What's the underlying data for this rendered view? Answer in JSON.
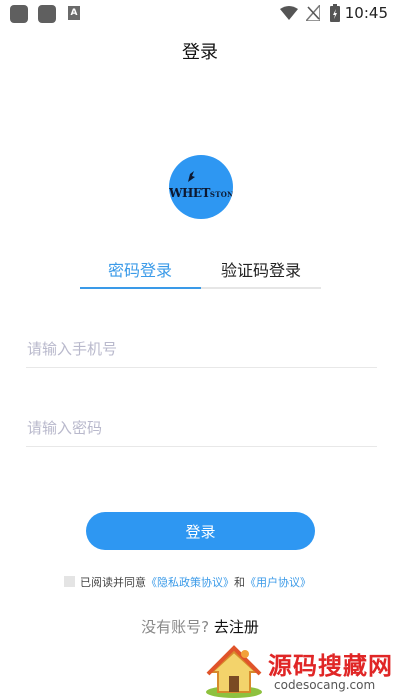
{
  "status_bar": {
    "time": "10:45",
    "badge": "A"
  },
  "header": {
    "title": "登录"
  },
  "logo": {
    "text_main": "WHET",
    "text_tail": "STONE"
  },
  "tabs": [
    {
      "label": "密码登录",
      "active": true
    },
    {
      "label": "验证码登录",
      "active": false
    }
  ],
  "form": {
    "phone_placeholder": "请输入手机号",
    "password_placeholder": "请输入密码",
    "login_label": "登录"
  },
  "agreement": {
    "prefix": "已阅读并同意",
    "privacy_link": "《隐私政策协议》",
    "and": "和",
    "user_link": "《用户协议》"
  },
  "register": {
    "prompt": "没有账号?",
    "link": "去注册"
  },
  "watermark": {
    "title": "源码搜藏网",
    "url": "codesocang.com"
  },
  "colors": {
    "accent": "#2e97f2",
    "link": "#3a9ae8",
    "watermark": "#e02626"
  }
}
